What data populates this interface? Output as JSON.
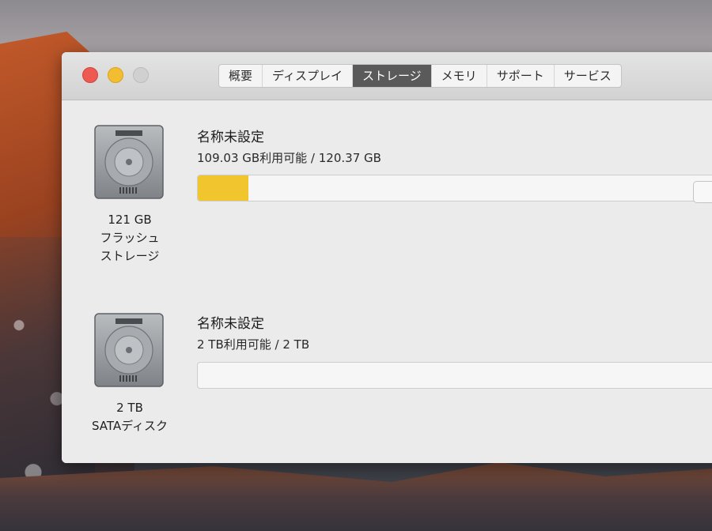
{
  "tabs": [
    {
      "label": "概要"
    },
    {
      "label": "ディスプレイ"
    },
    {
      "label": "ストレージ"
    },
    {
      "label": "メモリ"
    },
    {
      "label": "サポート"
    },
    {
      "label": "サービス"
    }
  ],
  "active_tab": "ストレージ",
  "disks": [
    {
      "icon": "hard-drive-icon",
      "caption_line1": "121 GB",
      "caption_line2": "フラッシュ",
      "caption_line3": "ストレージ",
      "volume_name": "名称未設定",
      "usage_text": "109.03 GB利用可能 / 120.37 GB",
      "used_fraction": 0.094,
      "bar_color": "#f0c52e"
    },
    {
      "icon": "hard-drive-icon",
      "caption_line1": "2 TB",
      "caption_line2": "SATAディスク",
      "volume_name": "名称未設定",
      "usage_text": "2 TB利用可能 / 2 TB",
      "used_fraction": 0.0,
      "bar_color": "#f0c52e"
    }
  ],
  "colors": {
    "close": "#ee5a52",
    "minimize": "#f2bd30",
    "zoom": "#d0d0d0",
    "active_tab_bg": "#5a5a5a"
  }
}
